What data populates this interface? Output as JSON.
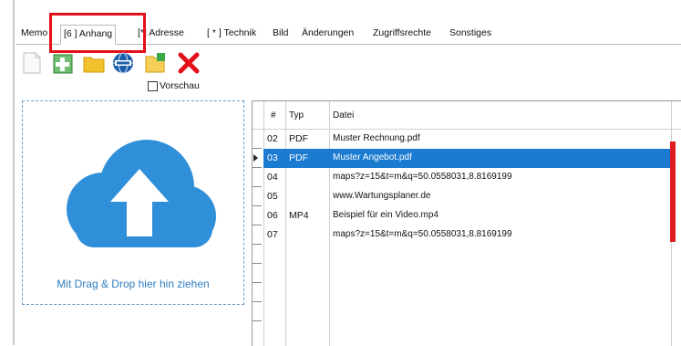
{
  "tabs": [
    {
      "label": "Memo"
    },
    {
      "label": "[6  ] Anhang"
    },
    {
      "label": "[*] Adresse"
    },
    {
      "label": "[ * ] Technik"
    },
    {
      "label": "Bild"
    },
    {
      "label": "Änderungen"
    },
    {
      "label": "Zugriffsrechte"
    },
    {
      "label": "Sonstiges"
    }
  ],
  "toolbar": {
    "icons": [
      "new-document-icon",
      "add-icon",
      "folder-icon",
      "web-icon",
      "open-folder-icon",
      "delete-icon"
    ],
    "colors": {
      "delete": "#e3101a",
      "folder": "#f2c12e",
      "add": "#39a64a",
      "web": "#1b5fa8"
    }
  },
  "preview": {
    "label": "Vorschau",
    "checked": false
  },
  "drop_zone": {
    "text": "Mit Drag & Drop hier hin ziehen",
    "icon": "cloud-upload-icon",
    "color": "#2f8fd8"
  },
  "table": {
    "columns": [
      "#",
      "Typ",
      "Datei"
    ],
    "rows": [
      {
        "num": "02",
        "type": "PDF",
        "file": "Muster Rechnung.pdf",
        "selected": false
      },
      {
        "num": "03",
        "type": "PDF",
        "file": "Muster Angebot.pdf",
        "selected": true
      },
      {
        "num": "04",
        "type": "",
        "file": "maps?z=15&t=m&q=50.0558031,8.8169199",
        "selected": false
      },
      {
        "num": "05",
        "type": "",
        "file": "www.Wartungsplaner.de",
        "selected": false
      },
      {
        "num": "06",
        "type": "MP4",
        "file": "Beispiel für ein Video.mp4",
        "selected": false
      },
      {
        "num": "07",
        "type": "",
        "file": "maps?z=15&t=m&q=50.0558031,8.8169199",
        "selected": false
      }
    ]
  },
  "colors": {
    "selection": "#1b7bd0",
    "highlight_box": "#e3101a"
  }
}
